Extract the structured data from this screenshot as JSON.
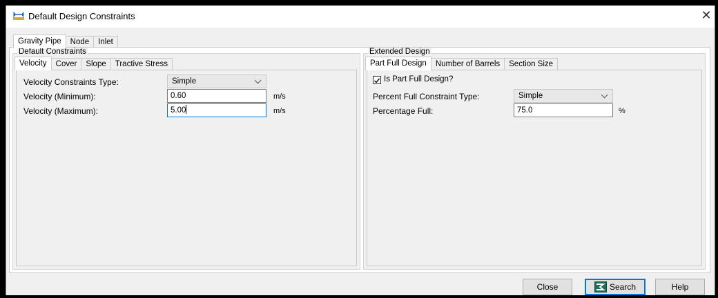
{
  "window": {
    "title": "Default Design Constraints"
  },
  "top_tabs": [
    "Gravity Pipe",
    "Node",
    "Inlet"
  ],
  "left_group": {
    "title": "Default Constraints",
    "tabs": [
      "Velocity",
      "Cover",
      "Slope",
      "Tractive Stress"
    ],
    "fields": {
      "type_label": "Velocity Constraints Type:",
      "type_value": "Simple",
      "min_label": "Velocity (Minimum):",
      "min_value": "0.60",
      "min_unit": "m/s",
      "max_label": "Velocity (Maximum):",
      "max_value": "5.00",
      "max_unit": "m/s"
    }
  },
  "right_group": {
    "title": "Extended Design",
    "tabs": [
      "Part Full Design",
      "Number of Barrels",
      "Section Size"
    ],
    "fields": {
      "checkbox_label": "Is Part Full Design?",
      "checkbox_checked": true,
      "type_label": "Percent Full Constraint Type:",
      "type_value": "Simple",
      "pct_label": "Percentage Full:",
      "pct_value": "75.0",
      "pct_unit": "%"
    }
  },
  "footer": {
    "close_label": "Close",
    "search_label": "Search",
    "help_label": "Help"
  }
}
